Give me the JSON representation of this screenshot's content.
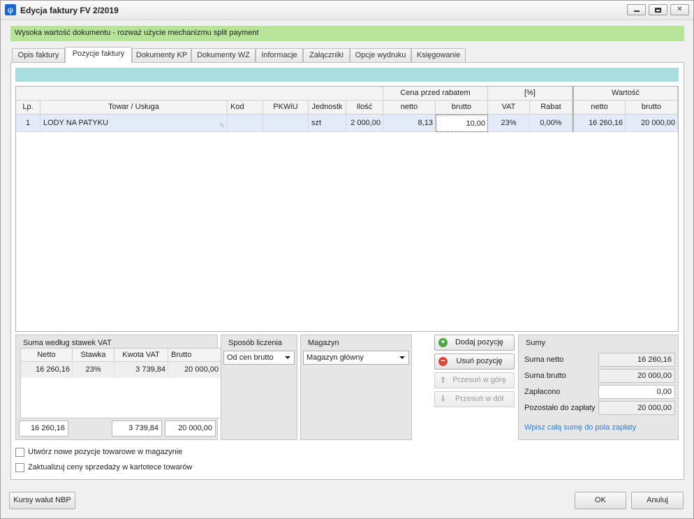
{
  "window": {
    "title": "Edycja faktury FV 2/2019",
    "app_icon": "φ",
    "controls": [
      "minimize-icon",
      "maximize-icon",
      "close-icon"
    ]
  },
  "alert": "Wysoka wartość dokumentu - rozważ użycie mechanizmu split payment",
  "tabs": [
    {
      "label": "Opis faktury",
      "active": false
    },
    {
      "label": "Pozycje faktury",
      "active": true
    },
    {
      "label": "Dokumenty KP",
      "active": false
    },
    {
      "label": "Dokumenty WZ",
      "active": false
    },
    {
      "label": "Informacje",
      "active": false
    },
    {
      "label": "Załączniki",
      "active": false
    },
    {
      "label": "Opcje wydruku",
      "active": false
    },
    {
      "label": "Księgowanie",
      "active": false
    }
  ],
  "items_grid": {
    "group_headers": {
      "price": "Cena przed rabatem",
      "percent": "[%]",
      "value": "Wartość"
    },
    "columns": [
      "Lp.",
      "Towar / Usługa",
      "Kod",
      "PKWiU",
      "Jednostk",
      "Ilość",
      "netto",
      "brutto",
      "VAT",
      "Rabat",
      "netto",
      "brutto"
    ],
    "rows": [
      [
        "1",
        "LODY NA PATYKU",
        "",
        "",
        "szt",
        "2 000,00",
        "8,13",
        "10,00",
        "23%",
        "0,00%",
        "16 260,16",
        "20 000,00"
      ]
    ]
  },
  "vat_summary": {
    "title": "Suma według stawek VAT",
    "columns": [
      "Netto",
      "Stawka",
      "Kwota VAT",
      "Brutto"
    ],
    "rows": [
      [
        "16 260,16",
        "23%",
        "3 739,84",
        "20 000,00"
      ]
    ],
    "totals": {
      "netto": "16 260,16",
      "vat": "3 739,84",
      "brutto": "20 000,00"
    }
  },
  "calc_method": {
    "title": "Sposób liczenia",
    "value": "Od cen brutto"
  },
  "warehouse": {
    "title": "Magazyn",
    "value": "Magazyn główny"
  },
  "actions": {
    "add": "Dodaj pozycję",
    "remove": "Usuń pozycję",
    "move_up": "Przesuń w górę",
    "move_down": "Przesuń w dół"
  },
  "sums": {
    "title": "Sumy",
    "netto_label": "Suma netto",
    "netto": "16 260,16",
    "brutto_label": "Suma brutto",
    "brutto": "20 000,00",
    "paid_label": "Zapłacono",
    "paid": "0,00",
    "remaining_label": "Pozostało do zapłaty",
    "remaining": "20 000,00",
    "link": "Wpisz całą sumę do pola zapłaty"
  },
  "options": {
    "create_positions": {
      "label": "Utwórz nowe pozycje towarowe w magazynie",
      "checked": false
    },
    "update_prices": {
      "label": "Zaktualizuj ceny sprzedaży w kartotece towarów",
      "checked": false
    }
  },
  "footer": {
    "rates": "Kursy walut NBP",
    "ok": "OK",
    "cancel": "Anuluj"
  }
}
